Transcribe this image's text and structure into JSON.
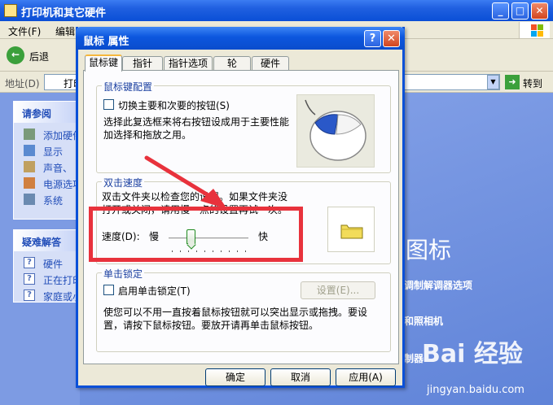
{
  "colors": {
    "accent": "#0a50d8",
    "annotation": "#e8323c",
    "group_title": "#1a3fa0"
  },
  "background_window": {
    "title": "打印机和其它硬件",
    "controls": {
      "minimize": "_",
      "maximize": "□",
      "close": "✕"
    },
    "menu": [
      "文件(F)",
      "编辑"
    ],
    "toolbar": {
      "back_label": "后退"
    },
    "address": {
      "label": "地址(D)",
      "value": "打印",
      "go_label": "转到"
    },
    "see_also": {
      "title": "请参阅",
      "items": [
        "添加硬件",
        "显示",
        "声音、",
        "电源选项",
        "系统"
      ]
    },
    "troubleshoot": {
      "title": "疑难解答",
      "items": [
        "硬件",
        "正在打印",
        "家庭或小"
      ]
    },
    "right_content": {
      "big_label": "图标",
      "link1": "调制解调器选项",
      "link2": "和照相机",
      "link3": "制器"
    },
    "watermark": {
      "main": "Bai 经验",
      "sub": "jingyan.baidu.com"
    }
  },
  "dialog": {
    "title": "鼠标 属性",
    "help_glyph": "?",
    "close_glyph": "✕",
    "tabs": [
      "鼠标键",
      "指针",
      "指针选项",
      "轮",
      "硬件"
    ],
    "active_tab": "鼠标键",
    "button_config": {
      "title": "鼠标键配置",
      "swap_label": "切换主要和次要的按钮(S)",
      "swap_checked": false,
      "description": "选择此复选框来将右按钮设成用于主要性能加选择和拖放之用。"
    },
    "double_click": {
      "title": "双击速度",
      "description": "双击文件夹以检查您的设置。如果文件夹没打开或关闭，请用慢一点的设置再试一次。",
      "speed_label": "速度(D):",
      "slow_label": "慢",
      "fast_label": "快",
      "speed_level": 0.25
    },
    "click_lock": {
      "title": "单击锁定",
      "enable_label": "启用单击锁定(T)",
      "enable_checked": false,
      "settings_label": "设置(E)...",
      "description": "使您可以不用一直按着鼠标按钮就可以突出显示或拖拽。要设置，请按下鼠标按钮。要放开请再单击鼠标按钮。"
    },
    "buttons": {
      "ok": "确定",
      "cancel": "取消",
      "apply": "应用(A)"
    }
  }
}
